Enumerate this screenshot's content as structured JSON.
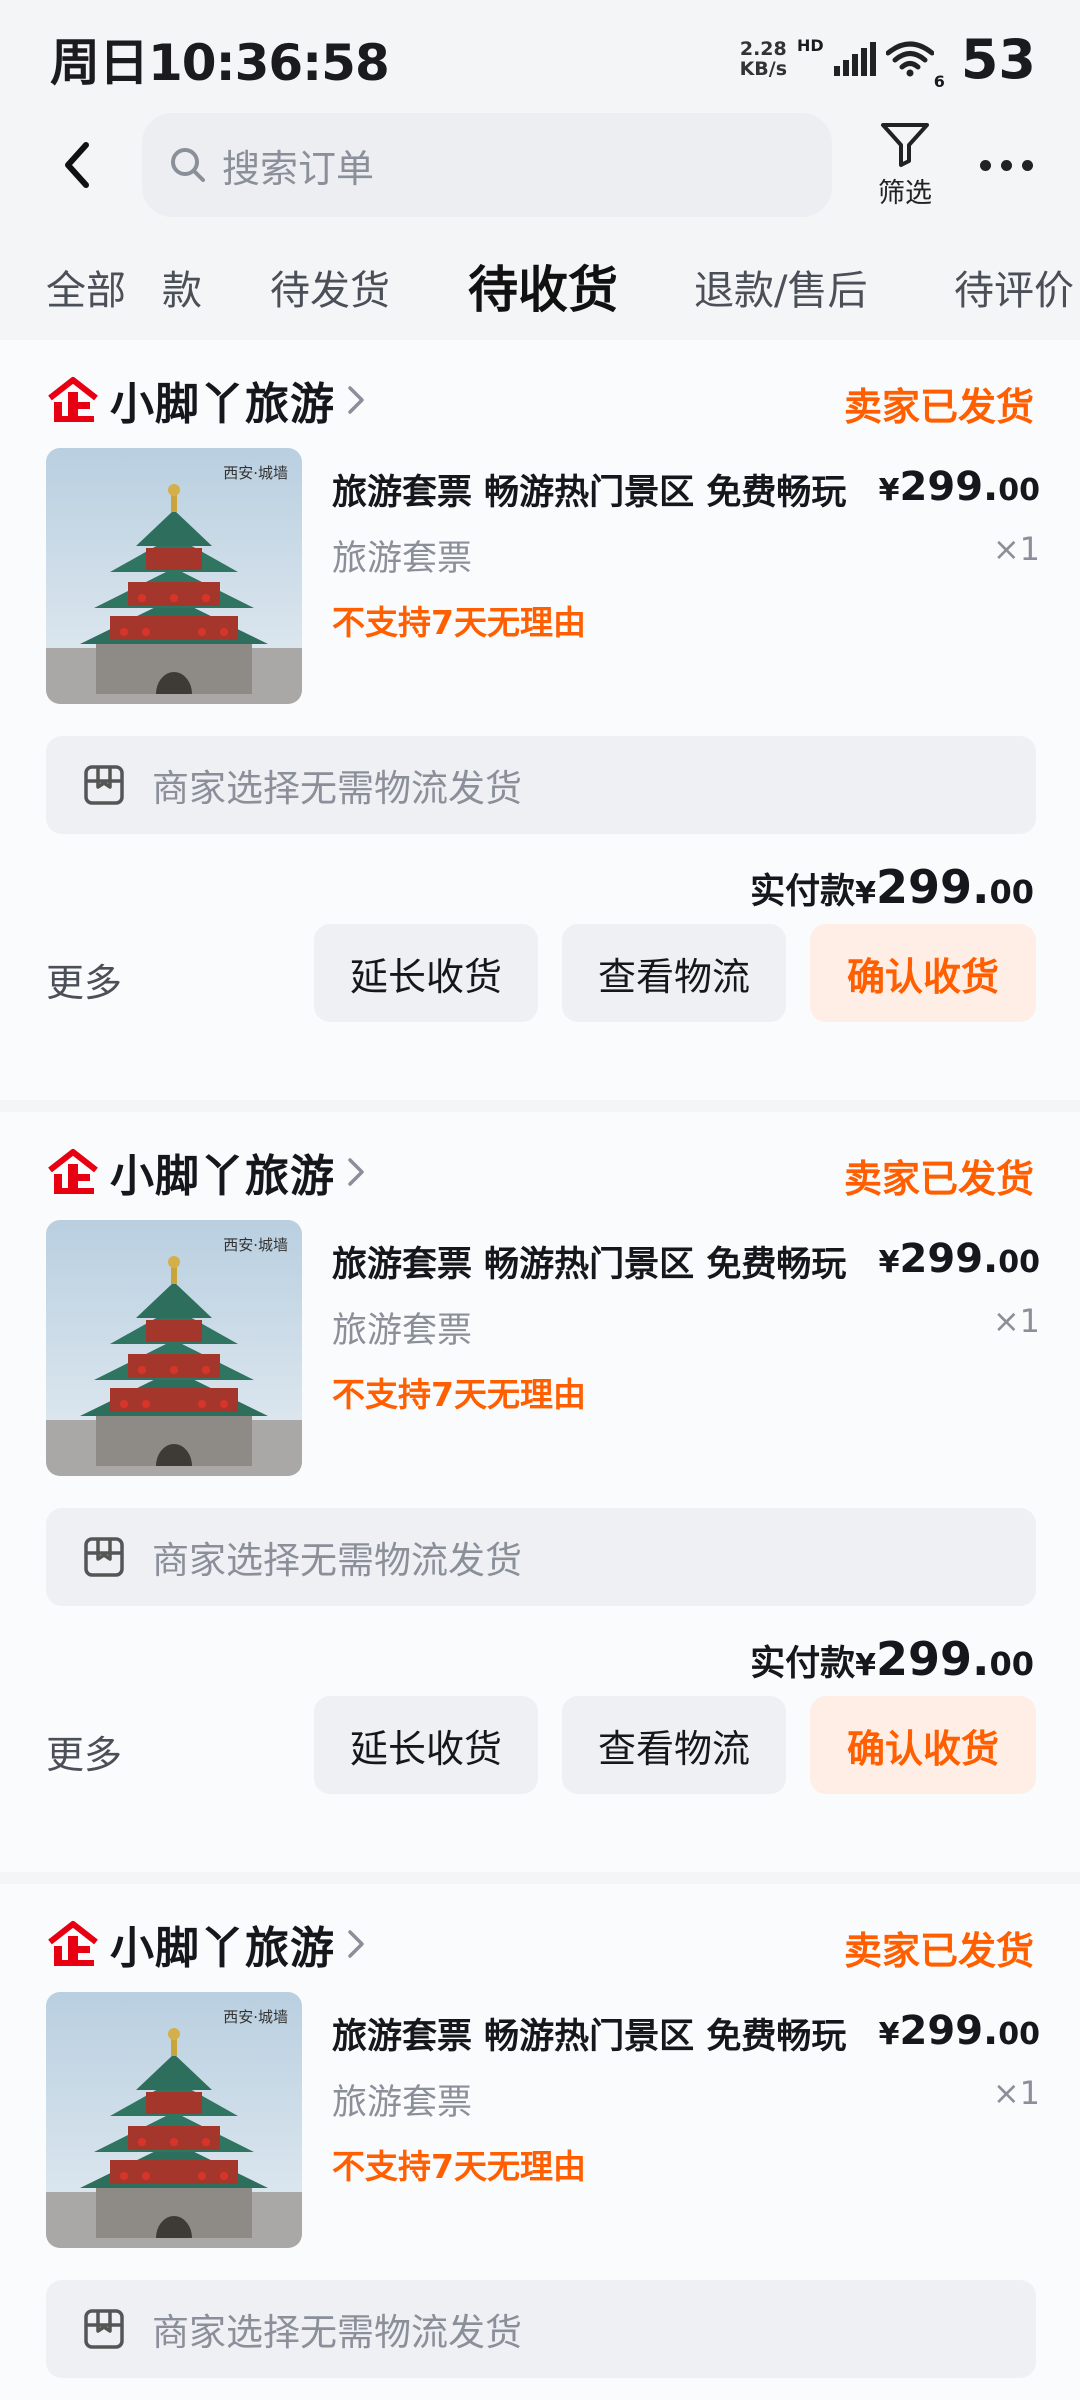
{
  "status_bar": {
    "time": "周日10:36:58",
    "net_speed_value": "2.28",
    "net_speed_unit": "KB/s",
    "hd_label": "HD",
    "wifi_gen": "6",
    "battery": "53"
  },
  "nav": {
    "search_placeholder": "搜索订单",
    "filter_label": "筛选"
  },
  "tabs": [
    {
      "label": "全部"
    },
    {
      "label": "款"
    },
    {
      "label": "待发货"
    },
    {
      "label": "待收货",
      "active": true
    },
    {
      "label": "退款/售后"
    },
    {
      "label": "待评价"
    }
  ],
  "orders": [
    {
      "shop_name": "小脚丫旅游",
      "status": "卖家已发货",
      "image_caption": "西安·城墙",
      "title": "旅游套票 畅游热门景区 免费畅玩",
      "sku": "旅游套票",
      "tag": "不支持7天无理由",
      "price_yen": "¥",
      "price_int": "299.",
      "price_dec": "00",
      "qty": "×1",
      "ship_note": "商家选择无需物流发货",
      "paid_label": "实付款",
      "paid_yen": "¥",
      "paid_int": "299.",
      "paid_dec": "00",
      "more": "更多",
      "btn_extend": "延长收货",
      "btn_logistics": "查看物流",
      "btn_confirm": "确认收货"
    },
    {
      "shop_name": "小脚丫旅游",
      "status": "卖家已发货",
      "image_caption": "西安·城墙",
      "title": "旅游套票 畅游热门景区 免费畅玩",
      "sku": "旅游套票",
      "tag": "不支持7天无理由",
      "price_yen": "¥",
      "price_int": "299.",
      "price_dec": "00",
      "qty": "×1",
      "ship_note": "商家选择无需物流发货",
      "paid_label": "实付款",
      "paid_yen": "¥",
      "paid_int": "299.",
      "paid_dec": "00",
      "more": "更多",
      "btn_extend": "延长收货",
      "btn_logistics": "查看物流",
      "btn_confirm": "确认收货"
    },
    {
      "shop_name": "小脚丫旅游",
      "status": "卖家已发货",
      "image_caption": "西安·城墙",
      "title": "旅游套票 畅游热门景区 免费畅玩",
      "sku": "旅游套票",
      "tag": "不支持7天无理由",
      "price_yen": "¥",
      "price_int": "299.",
      "price_dec": "00",
      "qty": "×1",
      "ship_note": "商家选择无需物流发货"
    }
  ],
  "colors": {
    "accent": "#ff5f00",
    "shop_icon_red": "#e60012",
    "muted_text": "#8a8f99"
  },
  "icons": {
    "back": "chevron-left-icon",
    "search": "search-icon",
    "filter": "funnel-icon",
    "more": "more-dots-icon",
    "shop": "enterprise-shop-icon",
    "shop_arrow": "chevron-right-icon",
    "ship": "package-box-icon"
  }
}
